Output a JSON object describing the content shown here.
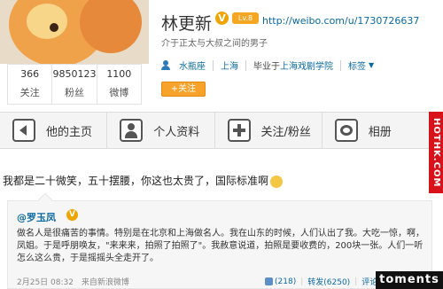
{
  "profile": {
    "name": "林更新",
    "level_badge": "Lv.8",
    "home_url": "http://weibo.com/u/1730726637",
    "intro": "介于正太与大叔之间的男子",
    "gender_icon": "person-icon",
    "zodiac": "水瓶座",
    "city": "上海",
    "school_prefix": "毕业于",
    "school": "上海戏剧学院",
    "tags_label": "标签",
    "follow_button": "+关注"
  },
  "stats": [
    {
      "value": "366",
      "label": "关注"
    },
    {
      "value": "9850123",
      "label": "粉丝"
    },
    {
      "value": "1100",
      "label": "微博"
    }
  ],
  "tabs": [
    {
      "label": "他的主页",
      "icon": "home-icon"
    },
    {
      "label": "个人资料",
      "icon": "person-icon"
    },
    {
      "label": "关注/粉丝",
      "icon": "follow-icon"
    },
    {
      "label": "相册",
      "icon": "photo-icon"
    }
  ],
  "watermark": "HOTHK.COM",
  "post": {
    "text": "我都是二十微笑，五十摆腰，你这也太贵了，国际标准啊"
  },
  "repost": {
    "author": "@罗玉凤",
    "body": "做名人是很痛苦的事情。特别是在北京和上海做名人。我在山东的时候，人们认出了我。大吃一惊，啊，凤姐。于是呼朋唤友，\"来来来，拍照了拍照了\"。我赦意说道，拍照是要收费的，200块一张。人们一听怎么这么贵，于是摇摇头全走开了。",
    "time": "2月25日 08:32",
    "source": "来自新浪微博",
    "like_count": "(218)",
    "repost_label": "转发(6250)",
    "comment_label": "评论"
  },
  "watermark_bottom": "toments"
}
